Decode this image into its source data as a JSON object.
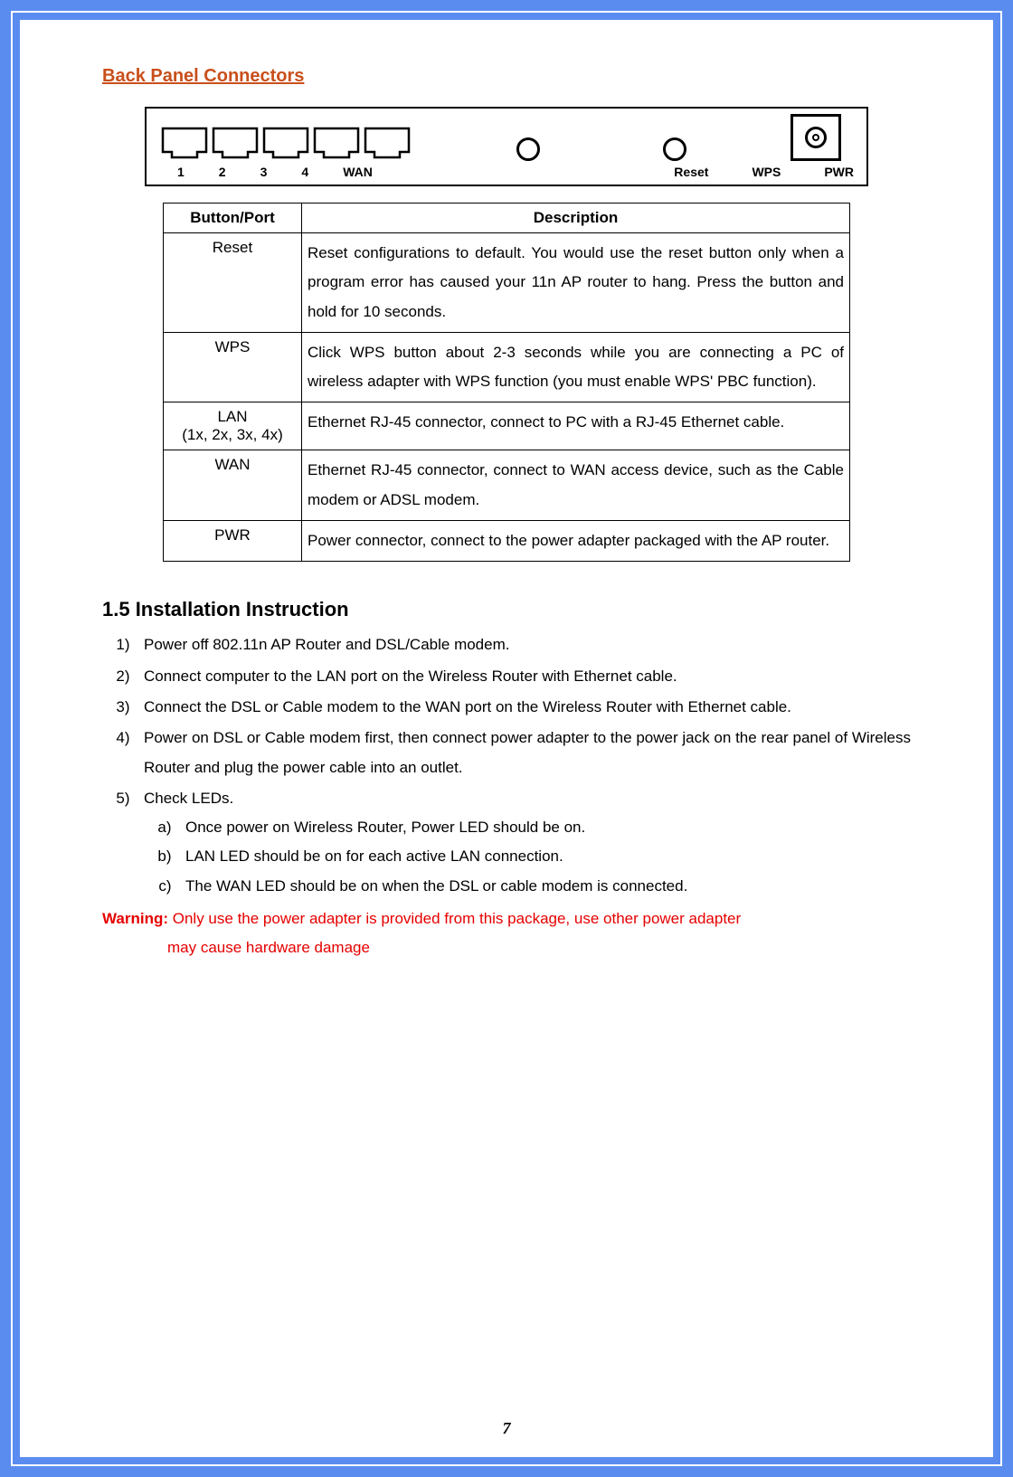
{
  "heading1": "Back Panel Connectors",
  "panel_labels": {
    "lan": [
      "1",
      "2",
      "3",
      "4"
    ],
    "wan": "WAN",
    "reset": "Reset",
    "wps": "WPS",
    "pwr": "PWR"
  },
  "table": {
    "headers": [
      "Button/Port",
      "Description"
    ],
    "rows": [
      {
        "port": "Reset",
        "port2": "",
        "desc": "Reset configurations to default. You would use the reset button only when a program error has caused your 11n AP router to hang. Press the button and hold for 10 seconds."
      },
      {
        "port": "WPS",
        "port2": "",
        "desc": "Click WPS button about 2-3 seconds while you are connecting a PC of wireless adapter with WPS function (you must enable WPS' PBC function)."
      },
      {
        "port": "LAN",
        "port2": "(1x, 2x, 3x, 4x)",
        "desc": "Ethernet RJ-45 connector, connect to PC with a RJ-45 Ethernet cable."
      },
      {
        "port": "WAN",
        "port2": "",
        "desc": "Ethernet RJ-45 connector, connect to WAN access device, such as the Cable modem or ADSL modem."
      },
      {
        "port": "PWR",
        "port2": "",
        "desc": "Power connector, connect to the power adapter packaged with the AP router."
      }
    ]
  },
  "heading2": "1.5 Installation Instruction",
  "steps": [
    "Power off 802.11n AP Router and DSL/Cable modem.",
    "Connect computer to the LAN port on the Wireless Router with Ethernet cable.",
    "Connect the DSL or Cable modem to the WAN port on the Wireless Router with Ethernet cable.",
    "Power on DSL or Cable modem first, then connect power adapter to the power jack on the rear panel of Wireless Router and plug the power cable into an outlet.",
    "Check LEDs."
  ],
  "substeps": [
    "Once power on Wireless Router, Power LED should be on.",
    "LAN LED should be on for each active LAN connection.",
    "The WAN LED should be on when the DSL or cable modem is connected."
  ],
  "warning_label": "Warning:",
  "warning_text1": " Only use the power adapter is provided from this package, use other power adapter",
  "warning_text2": "may cause hardware damage",
  "page_number": "7"
}
